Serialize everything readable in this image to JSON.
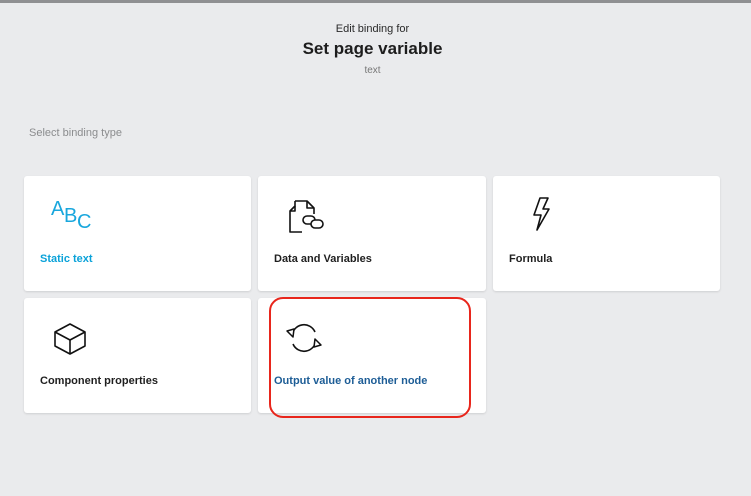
{
  "header": {
    "subtitle": "Edit binding for",
    "title": "Set page variable",
    "type": "text"
  },
  "section_label": "Select binding type",
  "cards": [
    {
      "label": "Static text",
      "icon": "abc-icon",
      "color": "#0aa2d9"
    },
    {
      "label": "Data and Variables",
      "icon": "document-link-icon"
    },
    {
      "label": "Formula",
      "icon": "lightning-icon"
    },
    {
      "label": "Component properties",
      "icon": "cube-icon"
    },
    {
      "label": "Output value of another node",
      "icon": "cycle-arrows-icon",
      "color": "#1d5d96",
      "highlighted": true
    }
  ],
  "abc_icon": {
    "a": "A",
    "b": "B",
    "c": "C"
  },
  "highlight_color": "#e8261c"
}
